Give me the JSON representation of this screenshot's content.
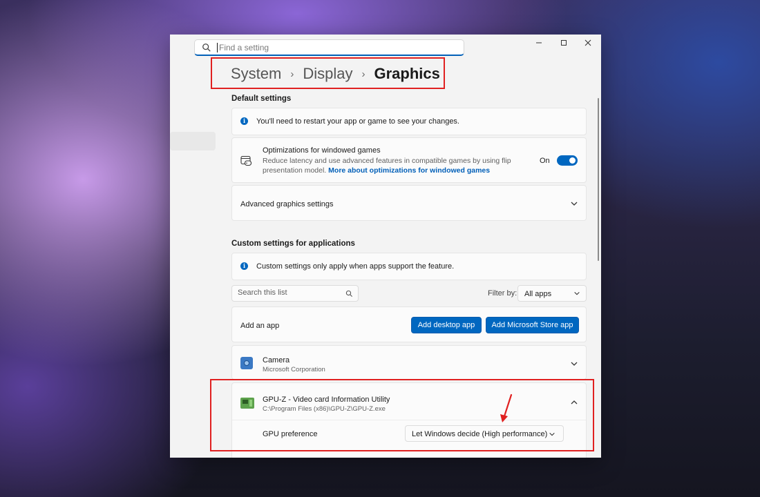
{
  "search": {
    "placeholder": "Find a setting"
  },
  "window_controls": {
    "minimize": "—",
    "maximize": "☐",
    "close": "✕"
  },
  "breadcrumb": {
    "items": [
      "System",
      "Display",
      "Graphics"
    ]
  },
  "default_settings": {
    "title": "Default settings",
    "info": "You'll need to restart your app or game to see your changes.",
    "windowed_games": {
      "title": "Optimizations for windowed games",
      "desc_line1": "Reduce latency and use advanced features in compatible games by using flip",
      "desc_line2": "presentation model.",
      "link": "More about optimizations for windowed games",
      "toggle_label": "On",
      "toggle_on": true
    },
    "advanced": "Advanced graphics settings"
  },
  "custom_settings": {
    "title": "Custom settings for applications",
    "info": "Custom settings only apply when apps support the feature.",
    "list_search_placeholder": "Search this list",
    "filter_label": "Filter by:",
    "filter_value": "All apps",
    "add_app_label": "Add an app",
    "add_desktop_button": "Add desktop app",
    "add_store_button": "Add Microsoft Store app",
    "apps": [
      {
        "name": "Camera",
        "publisher": "Microsoft Corporation"
      },
      {
        "name": "GPU-Z - Video card Information Utility",
        "publisher": "C:\\Program Files (x86)\\GPU-Z\\GPU-Z.exe"
      }
    ],
    "gpu_preference_label": "GPU preference",
    "gpu_preference_value": "Let Windows decide (High performance)"
  },
  "colors": {
    "accent": "#0067c0",
    "highlight": "#e02020"
  }
}
